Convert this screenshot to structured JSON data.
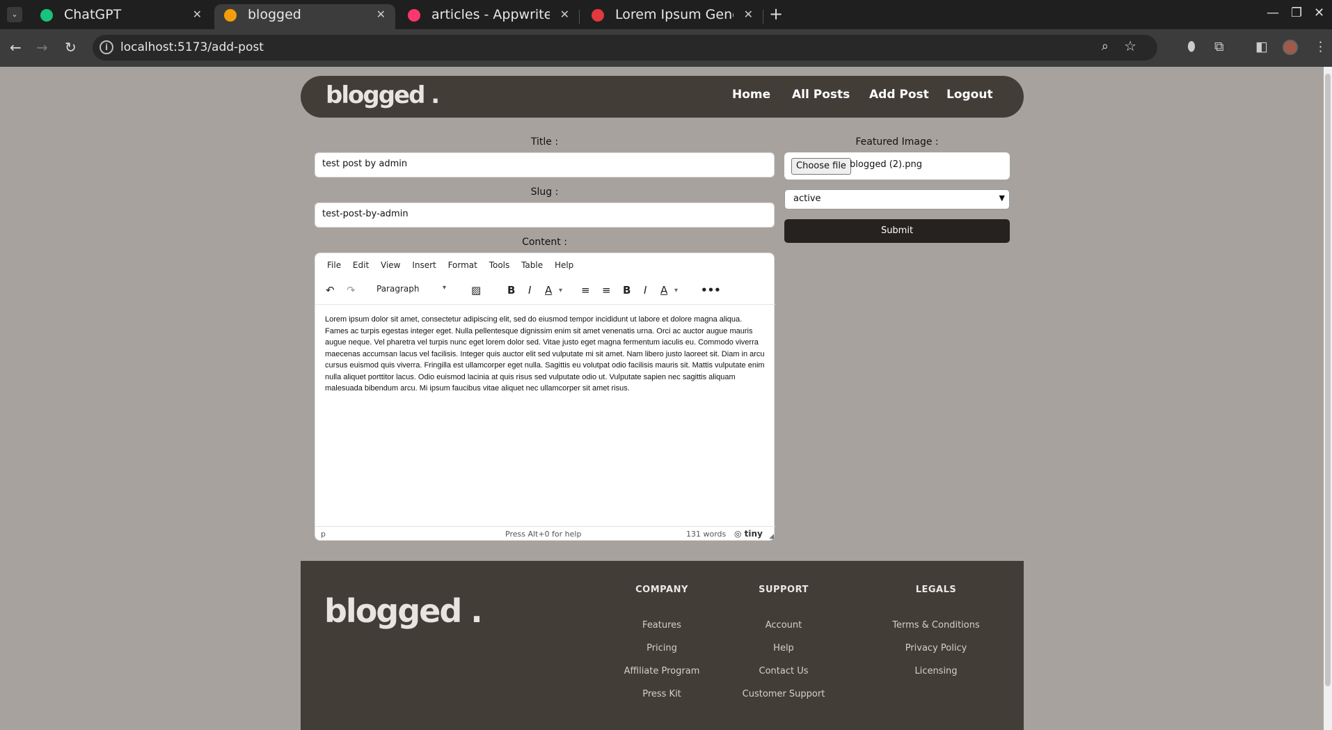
{
  "browser": {
    "tabs": [
      {
        "title": "ChatGPT",
        "favicon_color": "#19c37d"
      },
      {
        "title": "blogged",
        "favicon_color": "#f59e0b",
        "active": true
      },
      {
        "title": "articles - Appwrite",
        "favicon_color": "#fd366e"
      },
      {
        "title": "Lorem Ipsum Generato",
        "favicon_color": "#e0393e"
      }
    ],
    "url": "localhost:5173/add-post"
  },
  "site": {
    "logo": "blogged .",
    "nav": [
      "Home",
      "All Posts",
      "Add Post",
      "Logout"
    ]
  },
  "form": {
    "title_label": "Title :",
    "title_value": "test post by admin",
    "slug_label": "Slug :",
    "slug_value": "test-post-by-admin",
    "content_label": "Content :",
    "featured_label": "Featured Image :",
    "choose_file": "Choose file",
    "file_name": "blogged (2).png",
    "status_value": "active",
    "submit_label": "Submit"
  },
  "editor": {
    "menu": [
      "File",
      "Edit",
      "View",
      "Insert",
      "Format",
      "Tools",
      "Table",
      "Help"
    ],
    "block_format": "Paragraph",
    "content": "Lorem ipsum dolor sit amet, consectetur adipiscing elit, sed do eiusmod tempor incididunt ut labore et dolore magna aliqua. Fames ac turpis egestas integer eget. Nulla pellentesque dignissim enim sit amet venenatis urna. Orci ac auctor augue mauris augue neque. Vel pharetra vel turpis nunc eget lorem dolor sed. Vitae justo eget magna fermentum iaculis eu. Commodo viverra maecenas accumsan lacus vel facilisis. Integer quis auctor elit sed vulputate mi sit amet. Nam libero justo laoreet sit. Diam in arcu cursus euismod quis viverra. Fringilla est ullamcorper eget nulla. Sagittis eu volutpat odio facilisis mauris sit. Mattis vulputate enim nulla aliquet porttitor lacus. Odio euismod lacinia at quis risus sed vulputate odio ut. Vulputate sapien nec sagittis aliquam malesuada bibendum arcu. Mi ipsum faucibus vitae aliquet nec ullamcorper sit amet risus.",
    "status_path": "p",
    "status_help": "Press Alt+0 for help",
    "word_count": "131 words",
    "brand": "tiny"
  },
  "footer": {
    "logo": "blogged .",
    "columns": [
      {
        "heading": "COMPANY",
        "links": [
          "Features",
          "Pricing",
          "Affiliate Program",
          "Press Kit"
        ]
      },
      {
        "heading": "SUPPORT",
        "links": [
          "Account",
          "Help",
          "Contact Us",
          "Customer Support"
        ]
      },
      {
        "heading": "LEGALS",
        "links": [
          "Terms & Conditions",
          "Privacy Policy",
          "Licensing"
        ]
      }
    ]
  }
}
